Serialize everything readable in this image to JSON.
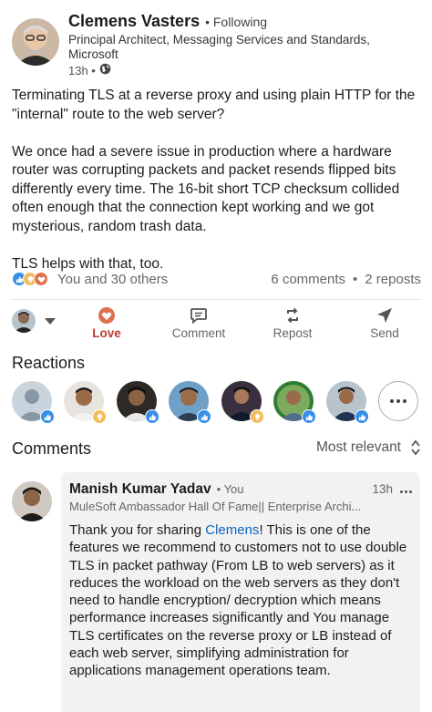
{
  "author": {
    "name": "Clemens Vasters",
    "following": "• Following",
    "headline": "Principal Architect, Messaging Services and Standards, Microsoft",
    "time": "13h •"
  },
  "post": {
    "text": "Terminating TLS at a reverse proxy and using plain HTTP for the \"internal\" route to the web server?\n\nWe once had a severe issue in production where a hardware router was corrupting packets and packet resends flipped bits differently every time. The 16-bit short TCP checksum collided often enough that the connection kept working and we got mysterious, random trash data.\n\nTLS helps with that, too."
  },
  "social": {
    "reactions_text": "You and 30 others",
    "comments": "6 comments",
    "separator": "•",
    "reposts": "2 reposts"
  },
  "actions": {
    "love": "Love",
    "comment": "Comment",
    "repost": "Repost",
    "send": "Send"
  },
  "reactions_title": "Reactions",
  "comments_title": "Comments",
  "sort_label": "Most relevant",
  "comment": {
    "name": "Manish Kumar Yadav",
    "you": "• You",
    "time": "13h",
    "headline": "MuleSoft Ambassador Hall Of Fame|| Enterprise Archi...",
    "text_before": "Thank you for sharing ",
    "mention": "Clemens",
    "text_after": "! This is one of the features we recommend to customers not to use double TLS in packet pathway (From LB to web servers) as it reduces the workload on the web servers as they don't need to handle encryption/ decryption which means performance increases significantly and You manage TLS certificates on the reverse proxy or LB instead of each web server, simplifying administration for applications management operations team."
  },
  "colors": {
    "like_blue": "#378fe9",
    "love_red": "#df704d",
    "insight_yellow": "#f5bb5c",
    "link_blue": "#0a66c2"
  }
}
